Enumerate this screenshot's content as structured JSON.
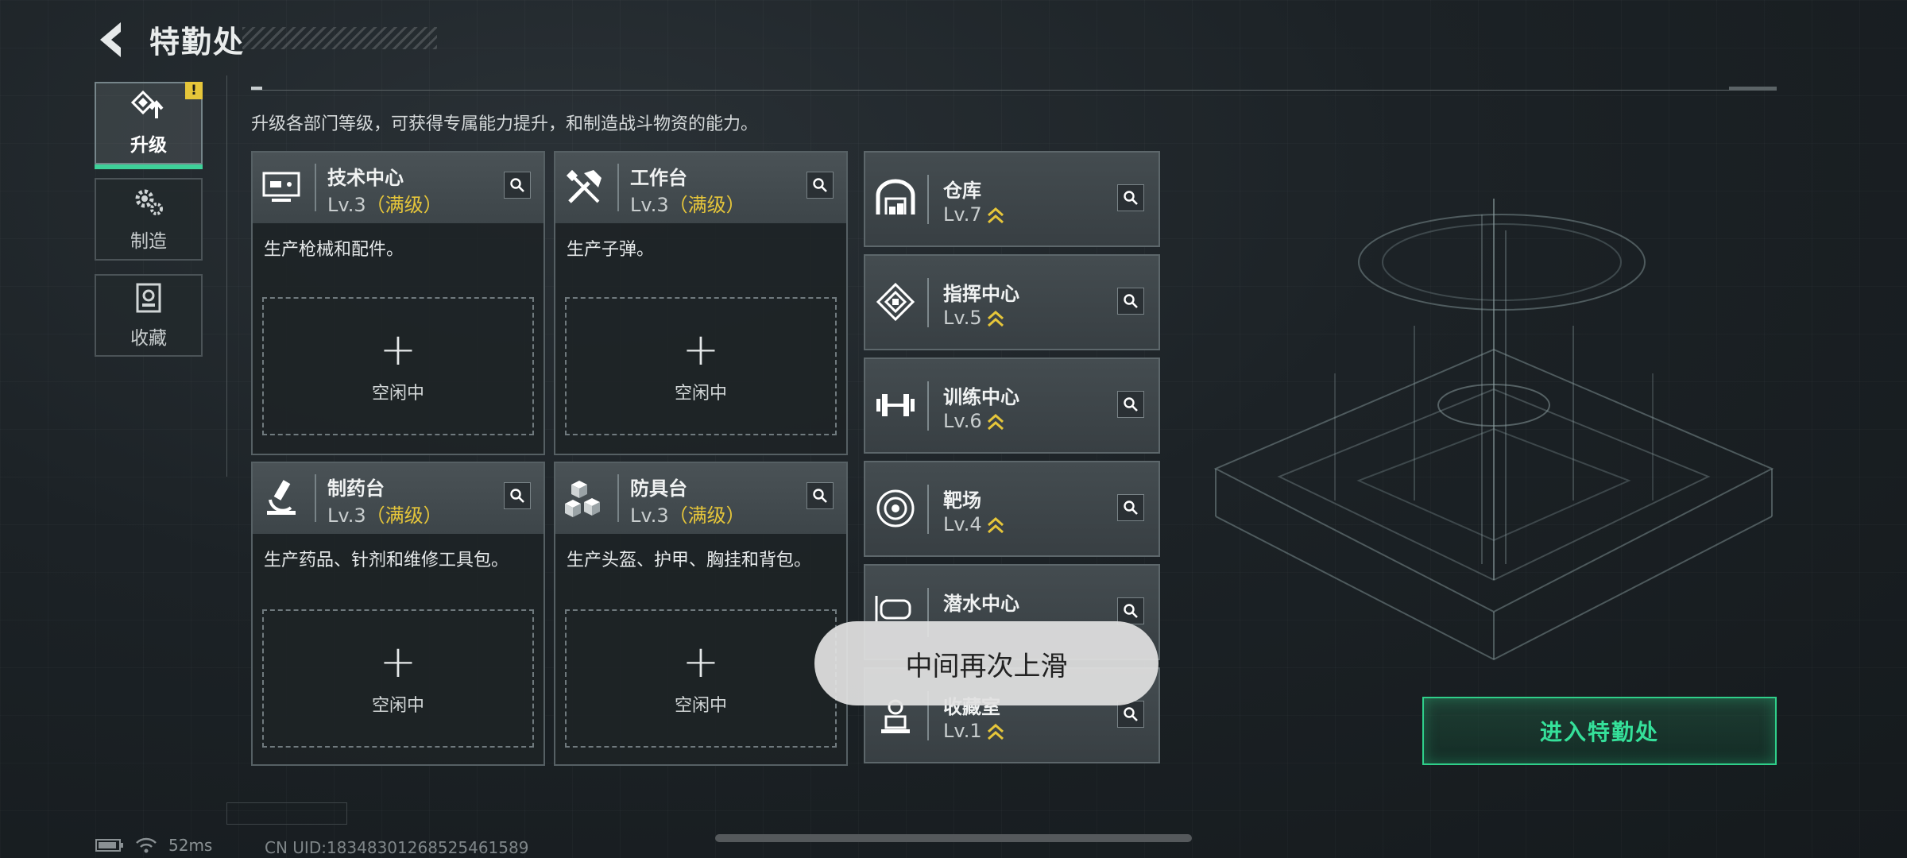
{
  "header": {
    "title": "特勤处"
  },
  "side_nav": {
    "items": [
      {
        "label": "升级",
        "icon": "upgrade-icon",
        "active": true,
        "alert": "!"
      },
      {
        "label": "制造",
        "icon": "gears-icon",
        "active": false
      },
      {
        "label": "收藏",
        "icon": "collection-icon",
        "active": false
      }
    ]
  },
  "main": {
    "intro": "升级各部门等级，可获得专属能力提升，和制造战斗物资的能力。",
    "stations": [
      {
        "name": "技术中心",
        "level": "Lv.3",
        "status": "（满级）",
        "desc": "生产枪械和配件。",
        "slot_label": "空闲中",
        "icon": "computer-icon"
      },
      {
        "name": "工作台",
        "level": "Lv.3",
        "status": "（满级）",
        "desc": "生产子弹。",
        "slot_label": "空闲中",
        "icon": "tools-icon"
      },
      {
        "name": "制药台",
        "level": "Lv.3",
        "status": "（满级）",
        "desc": "生产药品、针剂和维修工具包。",
        "slot_label": "空闲中",
        "icon": "microscope-icon"
      },
      {
        "name": "防具台",
        "level": "Lv.3",
        "status": "（满级）",
        "desc": "生产头盔、护甲、胸挂和背包。",
        "slot_label": "空闲中",
        "icon": "armor-boxes-icon"
      }
    ],
    "facilities": [
      {
        "name": "仓库",
        "level": "Lv.7",
        "icon": "warehouse-icon"
      },
      {
        "name": "指挥中心",
        "level": "Lv.5",
        "icon": "command-chip-icon"
      },
      {
        "name": "训练中心",
        "level": "Lv.6",
        "icon": "dumbbell-icon"
      },
      {
        "name": "靶场",
        "level": "Lv.4",
        "icon": "target-icon"
      },
      {
        "name": "潜水中心",
        "level": "",
        "icon": "diving-icon"
      },
      {
        "name": "收藏室",
        "level": "Lv.1",
        "icon": "collection-room-icon"
      }
    ],
    "enter_button": "进入特勤处"
  },
  "toast": {
    "text": "中间再次上滑"
  },
  "status_bar": {
    "ping": "52ms",
    "uid": "CN UID:183483012685254615​89"
  },
  "colors": {
    "accent_green": "#35e09a",
    "max_level_gold": "#e6c63a",
    "alert_yellow": "#e6c63a"
  }
}
